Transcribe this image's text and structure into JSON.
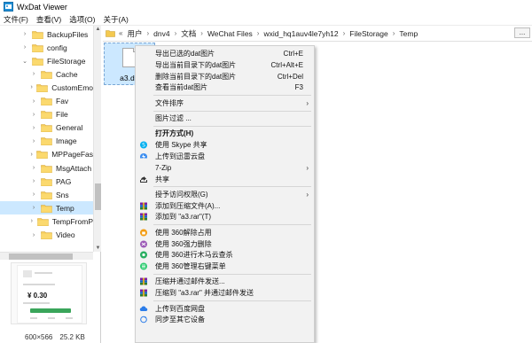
{
  "window": {
    "title": "WxDat Viewer"
  },
  "menubar": {
    "items": [
      "文件(F)",
      "查看(V)",
      "选项(O)",
      "关于(A)"
    ]
  },
  "tree": {
    "items": [
      {
        "label": "BackupFiles",
        "expanded": false,
        "selected": false
      },
      {
        "label": "config",
        "expanded": false,
        "selected": false
      },
      {
        "label": "FileStorage",
        "expanded": true,
        "selected": false
      },
      {
        "label": "Cache",
        "expanded": false,
        "selected": false
      },
      {
        "label": "CustomEmo",
        "expanded": false,
        "selected": false
      },
      {
        "label": "Fav",
        "expanded": false,
        "selected": false
      },
      {
        "label": "File",
        "expanded": false,
        "selected": false
      },
      {
        "label": "General",
        "expanded": false,
        "selected": false
      },
      {
        "label": "Image",
        "expanded": false,
        "selected": false
      },
      {
        "label": "MPPageFas",
        "expanded": false,
        "selected": false
      },
      {
        "label": "MsgAttach",
        "expanded": false,
        "selected": false
      },
      {
        "label": "PAG",
        "expanded": false,
        "selected": false
      },
      {
        "label": "Sns",
        "expanded": false,
        "selected": false
      },
      {
        "label": "Temp",
        "expanded": false,
        "selected": true
      },
      {
        "label": "TempFromP",
        "expanded": false,
        "selected": false
      },
      {
        "label": "Video",
        "expanded": false,
        "selected": false
      }
    ]
  },
  "preview": {
    "amount": "¥ 0.30"
  },
  "status": {
    "dimensions": "600×566",
    "size": "25.2 KB"
  },
  "address": {
    "chevron": "«",
    "crumbs": [
      "用户",
      "dnv4",
      "文档",
      "WeChat Files",
      "wxid_hq1auv4le7yh12",
      "FileStorage",
      "Temp"
    ],
    "more": "..."
  },
  "file": {
    "name": "a3.dat"
  },
  "context_menu": {
    "items": [
      {
        "label": "导出已选的dat图片",
        "shortcut": "Ctrl+E",
        "icon": ""
      },
      {
        "label": "导出当前目录下的dat图片",
        "shortcut": "Ctrl+Alt+E",
        "icon": ""
      },
      {
        "label": "删除当前目录下的dat图片",
        "shortcut": "Ctrl+Del",
        "icon": ""
      },
      {
        "label": "查看当前dat图片",
        "shortcut": "F3",
        "icon": ""
      },
      {
        "sep": true
      },
      {
        "label": "文件排序",
        "submenu": true,
        "icon": ""
      },
      {
        "sep": true
      },
      {
        "label": "图片过滤 ...",
        "icon": ""
      },
      {
        "sep": true
      },
      {
        "label": "打开方式(H)",
        "bold": true,
        "icon": ""
      },
      {
        "label": "使用 Skype 共享",
        "icon": "skype-icon"
      },
      {
        "label": "上传到迅雷云盘",
        "icon": "thunder-icon"
      },
      {
        "label": "7-Zip",
        "submenu": true,
        "icon": ""
      },
      {
        "label": "共享",
        "icon": "share-icon"
      },
      {
        "sep": true
      },
      {
        "label": "授予访问权限(G)",
        "submenu": true,
        "icon": ""
      },
      {
        "label": "添加到压缩文件(A)...",
        "icon": "winrar-icon"
      },
      {
        "label": "添加到 \"a3.rar\"(T)",
        "icon": "winrar-icon"
      },
      {
        "sep": true
      },
      {
        "label": "使用 360解除占用",
        "icon": "360-unlock-icon"
      },
      {
        "label": "使用 360强力删除",
        "icon": "360-delete-icon"
      },
      {
        "label": "使用 360进行木马云查杀",
        "icon": "360-scan-icon"
      },
      {
        "label": "使用 360管理右键菜单",
        "icon": "360-menu-icon"
      },
      {
        "sep": true
      },
      {
        "label": "压缩并通过邮件发送...",
        "icon": "winrar-icon"
      },
      {
        "label": "压缩到 \"a3.rar\" 并通过邮件发送",
        "icon": "winrar-icon"
      },
      {
        "sep": true
      },
      {
        "label": "上传到百度网盘",
        "icon": "baidu-cloud-icon"
      },
      {
        "label": "同步至其它设备",
        "icon": "sync-icon"
      }
    ]
  }
}
